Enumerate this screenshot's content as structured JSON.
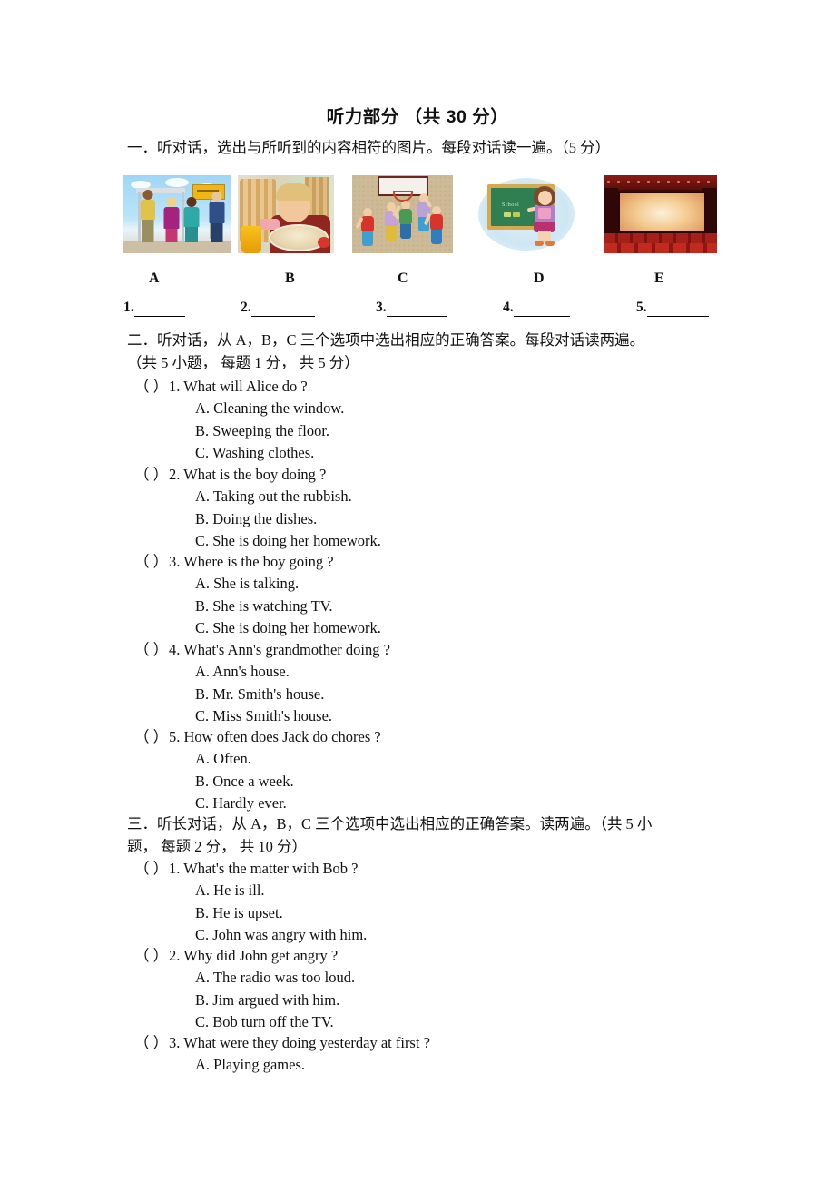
{
  "document": {
    "title": "听力部分  （共 30 分）",
    "sections": [
      {
        "id": "section-1",
        "heading": "一．听对话，选出与所听到的内容相符的图片。每段对话读一遍。（5 分）",
        "image_labels": [
          "A",
          "B",
          "C",
          "D",
          "E"
        ],
        "images": [
          {
            "label": "A",
            "alt": "people waiting at a bus stop"
          },
          {
            "label": "B",
            "alt": "boy eating at a table with juice"
          },
          {
            "label": "C",
            "alt": "children playing basketball"
          },
          {
            "label": "D",
            "alt": "girl writing School on a blackboard"
          },
          {
            "label": "E",
            "alt": "cinema theater with screen and red seats"
          }
        ],
        "blackboard_word": "School",
        "answer_blanks": [
          "1.",
          "2.",
          "3.",
          "4.",
          "5."
        ]
      },
      {
        "id": "section-2",
        "heading_line1": "二．听对话，从 A，B，C 三个选项中选出相应的正确答案。每段对话读两遍。",
        "heading_line2": "（共 5 小题， 每题 1 分， 共 5 分）",
        "questions": [
          {
            "paren": "（  ）",
            "number": "1.",
            "text": "What will Alice do ?",
            "options": [
              "A. Cleaning the window.",
              "B. Sweeping the floor.",
              "C. Washing clothes."
            ]
          },
          {
            "paren": "（  ）",
            "number": "2.",
            "text": "What is the boy doing ?",
            "options": [
              "A. Taking out the rubbish.",
              "B. Doing the dishes.",
              "C. She is doing her homework."
            ]
          },
          {
            "paren": "（  ）",
            "number": "3.",
            "text": "Where is the boy going ?",
            "options": [
              "A. She is talking.",
              "B. She is watching TV.",
              "C. She is doing her homework."
            ]
          },
          {
            "paren": "（  ）",
            "number": "4.",
            "text": "What's Ann's grandmother doing ?",
            "options": [
              "A. Ann's house.",
              "B. Mr. Smith's house.",
              "C. Miss Smith's house."
            ]
          },
          {
            "paren": "（  ）",
            "number": "5.",
            "text": "How often does Jack do chores ?",
            "options": [
              "A. Often.",
              "B. Once a week.",
              "C. Hardly ever."
            ]
          }
        ]
      },
      {
        "id": "section-3",
        "heading_line1": "三．听长对话，从 A，B，C 三个选项中选出相应的正确答案。读两遍。（共 5 小",
        "heading_line2": "题， 每题 2 分， 共 10 分）",
        "questions": [
          {
            "paren": "（  ）",
            "number": "1.",
            "text": "What's the matter with Bob ?",
            "options": [
              "A. He is ill.",
              "B. He is upset.",
              "C. John was angry with him."
            ]
          },
          {
            "paren": "（  ）",
            "number": "2.",
            "text": "Why did John get angry ?",
            "options": [
              "A. The radio was too loud.",
              "B. Jim argued with him.",
              "C. Bob turn off the TV."
            ]
          },
          {
            "paren": "（  ）",
            "number": "3.",
            "text": "What were they doing yesterday at first ?",
            "options": [
              "A. Playing games."
            ]
          }
        ]
      }
    ]
  }
}
